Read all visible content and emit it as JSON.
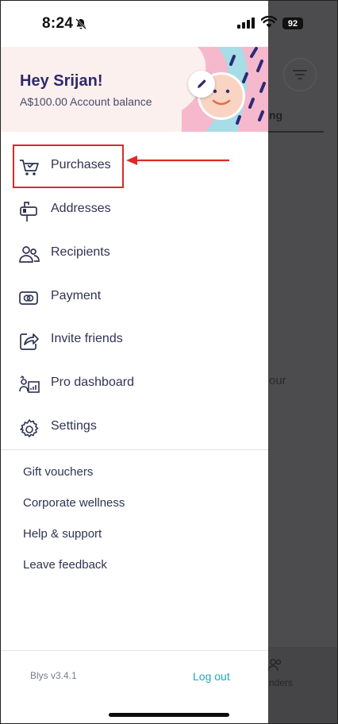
{
  "status_bar": {
    "time": "8:24",
    "battery": "92"
  },
  "header": {
    "greeting": "Hey Srijan!",
    "balance": "A$100.00 Account balance"
  },
  "menu": {
    "items": [
      {
        "label": "Purchases",
        "icon": "cart-icon"
      },
      {
        "label": "Addresses",
        "icon": "mailbox-icon"
      },
      {
        "label": "Recipients",
        "icon": "users-icon"
      },
      {
        "label": "Payment",
        "icon": "card-icon"
      },
      {
        "label": "Invite friends",
        "icon": "share-icon"
      },
      {
        "label": "Pro dashboard",
        "icon": "dashboard-icon"
      },
      {
        "label": "Settings",
        "icon": "gear-icon"
      }
    ]
  },
  "links": [
    "Gift vouchers",
    "Corporate wellness",
    "Help & support",
    "Leave feedback"
  ],
  "footer": {
    "version": "Blys v3.4.1",
    "logout": "Log out"
  },
  "background": {
    "tab_text": "ng",
    "body_text": "our",
    "nav_label": "nders"
  },
  "colors": {
    "brand_navy": "#2e2a6b",
    "logout_teal": "#1fa7b8",
    "annotation_red": "#d92b2b",
    "header_bg": "#fbf0ee"
  }
}
